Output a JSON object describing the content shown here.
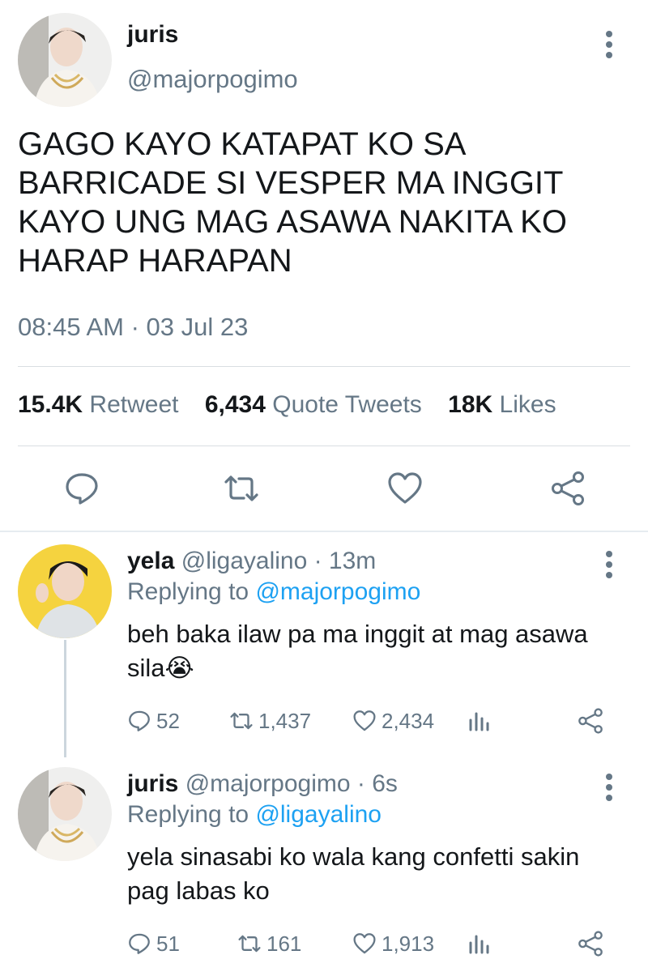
{
  "main_tweet": {
    "name": "juris",
    "handle": "@majorpogimo",
    "text": "GAGO KAYO KATAPAT KO SA BARRICADE SI VESPER MA INGGIT KAYO UNG MAG ASAWA NAKITA KO HARAP HARAPAN",
    "timestamp": "08:45 AM · 03 Jul 23",
    "stats": {
      "retweets_count": "15.4K",
      "retweets_label": "Retweet",
      "quotes_count": "6,434",
      "quotes_label": "Quote Tweets",
      "likes_count": "18K",
      "likes_label": "Likes"
    },
    "actions": [
      "reply-icon",
      "retweet-icon",
      "like-icon",
      "share-icon"
    ]
  },
  "replies": [
    {
      "name": "yela",
      "meta": "@ligayalino · 13m",
      "replying_prefix": "Replying to",
      "replying_to": "@majorpogimo",
      "text": "beh baka ilaw pa ma inggit at mag asawa sila😭",
      "replies": "52",
      "retweets": "1,437",
      "likes": "2,434"
    },
    {
      "name": "juris",
      "meta": "@majorpogimo · 6s",
      "replying_prefix": "Replying to",
      "replying_to": "@ligayalino",
      "text": "yela sinasabi ko wala kang confetti sakin pag labas ko",
      "replies": "51",
      "retweets": "161",
      "likes": "1,913"
    }
  ],
  "colors": {
    "accent": "#1da1f2",
    "secondary_text": "#657786",
    "primary_text": "#14171a",
    "divider": "#e6ecf0"
  }
}
